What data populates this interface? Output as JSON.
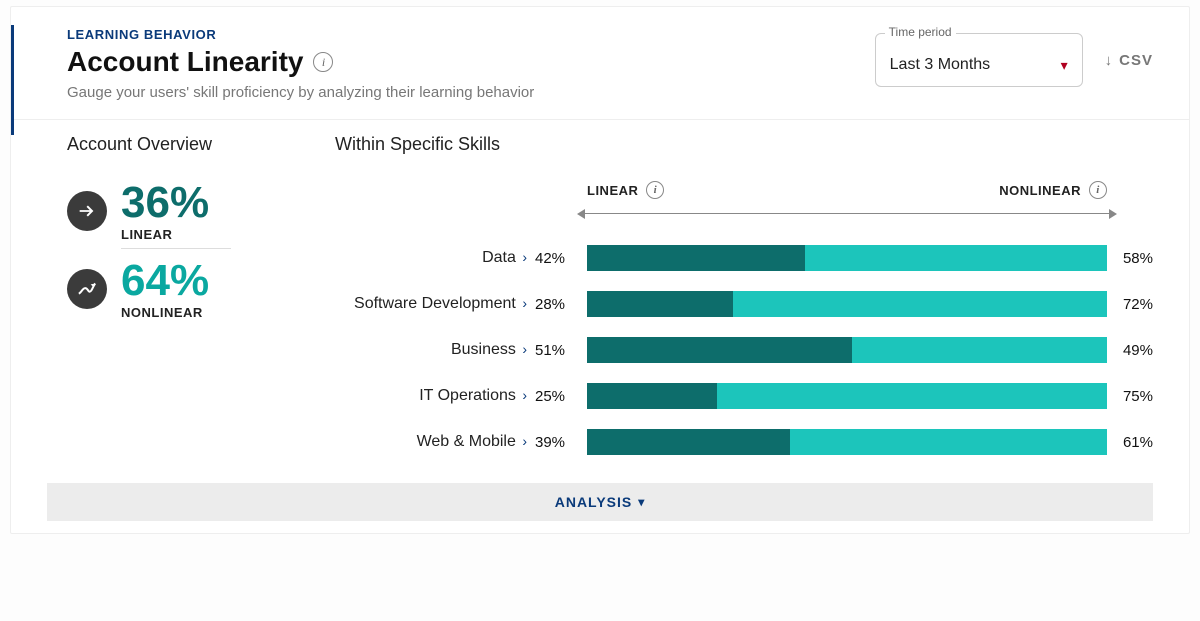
{
  "header": {
    "eyebrow": "LEARNING BEHAVIOR",
    "title": "Account Linearity",
    "subtitle": "Gauge your users' skill proficiency by analyzing their learning behavior",
    "time_period_label": "Time period",
    "time_period_value": "Last 3 Months",
    "csv_label": "CSV"
  },
  "overview": {
    "section_title": "Account Overview",
    "linear_pct": "36%",
    "linear_label": "LINEAR",
    "nonlinear_pct": "64%",
    "nonlinear_label": "NONLINEAR"
  },
  "skills": {
    "section_title": "Within Specific Skills",
    "linear_header": "LINEAR",
    "nonlinear_header": "NONLINEAR",
    "rows": [
      {
        "name": "Data",
        "linear": 42,
        "nonlinear": 58
      },
      {
        "name": "Software Development",
        "linear": 28,
        "nonlinear": 72
      },
      {
        "name": "Business",
        "linear": 51,
        "nonlinear": 49
      },
      {
        "name": "IT Operations",
        "linear": 25,
        "nonlinear": 75
      },
      {
        "name": "Web & Mobile",
        "linear": 39,
        "nonlinear": 61
      }
    ]
  },
  "analysis_label": "ANALYSIS",
  "colors": {
    "linear": "#0d6d6b",
    "nonlinear": "#1cc5bb",
    "accent_navy": "#0a3a7a",
    "accent_red": "#b00020"
  },
  "chart_data": {
    "type": "bar",
    "title": "Account Linearity — Within Specific Skills",
    "xlabel": "",
    "ylabel": "Percent",
    "ylim": [
      0,
      100
    ],
    "categories": [
      "Data",
      "Software Development",
      "Business",
      "IT Operations",
      "Web & Mobile"
    ],
    "series": [
      {
        "name": "Linear",
        "values": [
          42,
          28,
          51,
          25,
          39
        ]
      },
      {
        "name": "Nonlinear",
        "values": [
          58,
          72,
          49,
          75,
          61
        ]
      }
    ],
    "overview": {
      "linear": 36,
      "nonlinear": 64
    }
  }
}
